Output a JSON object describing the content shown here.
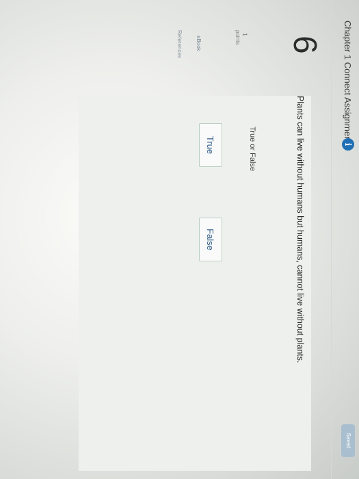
{
  "header": {
    "title": "Chapter 1 Connect Assignment",
    "info_icon": "i",
    "saved_label": "Saved"
  },
  "question": {
    "number": "6",
    "points_value": "1",
    "points_label": "points",
    "text": "Plants can live without humans but humans, cannot live without plants.",
    "type_label": "True or False",
    "options": [
      "True",
      "False"
    ]
  },
  "sidebar": {
    "ebook_label": "eBook",
    "references_label": "References"
  },
  "colors": {
    "info_icon": "#1f6fb5",
    "saved_badge": "#a9bfcf",
    "button_text": "#2d5c86"
  }
}
